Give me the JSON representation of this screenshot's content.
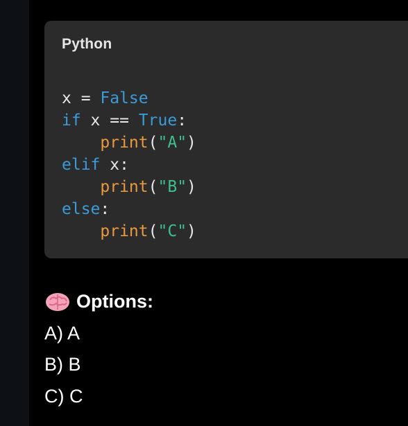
{
  "code_card": {
    "language": "Python",
    "lines": [
      [
        {
          "t": "x = ",
          "k": "plain"
        },
        {
          "t": "False",
          "k": "kw"
        }
      ],
      [
        {
          "t": "if",
          "k": "kw"
        },
        {
          "t": " x == ",
          "k": "plain"
        },
        {
          "t": "True",
          "k": "kw"
        },
        {
          "t": ":",
          "k": "plain"
        }
      ],
      [
        {
          "t": "    ",
          "k": "plain"
        },
        {
          "t": "print",
          "k": "fn"
        },
        {
          "t": "(",
          "k": "plain"
        },
        {
          "t": "\"A\"",
          "k": "str"
        },
        {
          "t": ")",
          "k": "plain"
        }
      ],
      [
        {
          "t": "elif",
          "k": "kw"
        },
        {
          "t": " x:",
          "k": "plain"
        }
      ],
      [
        {
          "t": "    ",
          "k": "plain"
        },
        {
          "t": "print",
          "k": "fn"
        },
        {
          "t": "(",
          "k": "plain"
        },
        {
          "t": "\"B\"",
          "k": "str"
        },
        {
          "t": ")",
          "k": "plain"
        }
      ],
      [
        {
          "t": "else",
          "k": "kw"
        },
        {
          "t": ":",
          "k": "plain"
        }
      ],
      [
        {
          "t": "    ",
          "k": "plain"
        },
        {
          "t": "print",
          "k": "fn"
        },
        {
          "t": "(",
          "k": "plain"
        },
        {
          "t": "\"C\"",
          "k": "str"
        },
        {
          "t": ")",
          "k": "plain"
        }
      ]
    ]
  },
  "options": {
    "icon": "brain-icon",
    "heading": "Options:",
    "items": [
      "A) A",
      "B) B",
      "C) C"
    ]
  },
  "colors": {
    "keyword": "#3b9ad8",
    "function": "#e89a3c",
    "string": "#3fbf8f",
    "card_bg": "#2b2b2b",
    "page_bg": "#000000"
  }
}
